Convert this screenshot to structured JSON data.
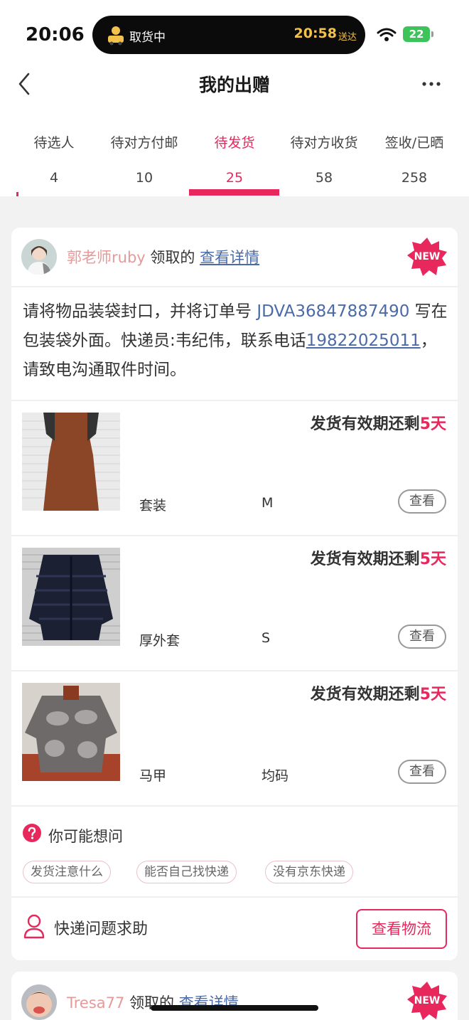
{
  "status_bar": {
    "time": "20:06",
    "island_label": "取货中",
    "island_time": "20:58",
    "island_sub": "送达",
    "battery": "22"
  },
  "header": {
    "title": "我的出赠"
  },
  "tabs": [
    {
      "label": "待选人",
      "count": "4"
    },
    {
      "label": "待对方付邮",
      "count": "10"
    },
    {
      "label": "待发货",
      "count": "25"
    },
    {
      "label": "待对方收货",
      "count": "58"
    },
    {
      "label": "签收/已晒",
      "count": "258"
    }
  ],
  "card1": {
    "user": "郭老师ruby",
    "claim_verb": "领取的",
    "detail_link": "查看详情",
    "badge": "NEW",
    "instruction_a": "请将物品装袋封口，并将订单号 ",
    "order_no": "JDVA36847887490",
    "instruction_b": " 写在包装袋外面。快递员:韦纪伟，联系电话",
    "phone": "19822025011",
    "instruction_c": "，请致电沟通取件时间。",
    "items": [
      {
        "deadline_prefix": "发货有效期还剩",
        "days": "5天",
        "category": "套装",
        "size": "M",
        "view": "查看"
      },
      {
        "deadline_prefix": "发货有效期还剩",
        "days": "5天",
        "category": "厚外套",
        "size": "S",
        "view": "查看"
      },
      {
        "deadline_prefix": "发货有效期还剩",
        "days": "5天",
        "category": "马甲",
        "size": "均码",
        "view": "查看"
      }
    ],
    "faq_title": "你可能想问",
    "faq_chips": [
      "发货注意什么",
      "能否自己找快递",
      "没有京东快递"
    ],
    "help_label": "快递问题求助",
    "logistics_button": "查看物流"
  },
  "card2": {
    "user": "Tresa77",
    "claim_verb": "领取的",
    "detail_link": "查看详情",
    "badge": "NEW"
  },
  "colors": {
    "accent": "#e8285c",
    "link": "#4b6aa8",
    "username": "#e59a9a"
  }
}
